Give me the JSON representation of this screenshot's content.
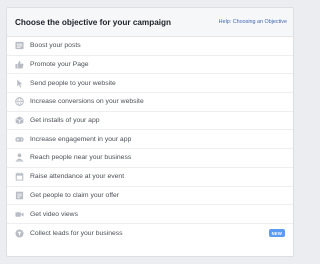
{
  "header": {
    "title": "Choose the objective for your campaign",
    "help_link": "Help: Choosing an Objective"
  },
  "icon_color": "#b8bcc4",
  "accent": "#4267b2",
  "badge_color": "#5b9bf0",
  "objectives": [
    {
      "label": "Boost your posts",
      "icon": "posts-icon"
    },
    {
      "label": "Promote your Page",
      "icon": "thumbs-up-icon"
    },
    {
      "label": "Send people to your website",
      "icon": "cursor-icon"
    },
    {
      "label": "Increase conversions on your website",
      "icon": "globe-icon"
    },
    {
      "label": "Get installs of your app",
      "icon": "box-icon"
    },
    {
      "label": "Increase engagement in your app",
      "icon": "gamepad-icon"
    },
    {
      "label": "Reach people near your business",
      "icon": "person-location-icon"
    },
    {
      "label": "Raise attendance at your event",
      "icon": "calendar-icon"
    },
    {
      "label": "Get people to claim your offer",
      "icon": "offer-icon"
    },
    {
      "label": "Get video views",
      "icon": "video-camera-icon"
    },
    {
      "label": "Collect leads for your business",
      "icon": "funnel-icon",
      "badge": "NEW"
    }
  ]
}
